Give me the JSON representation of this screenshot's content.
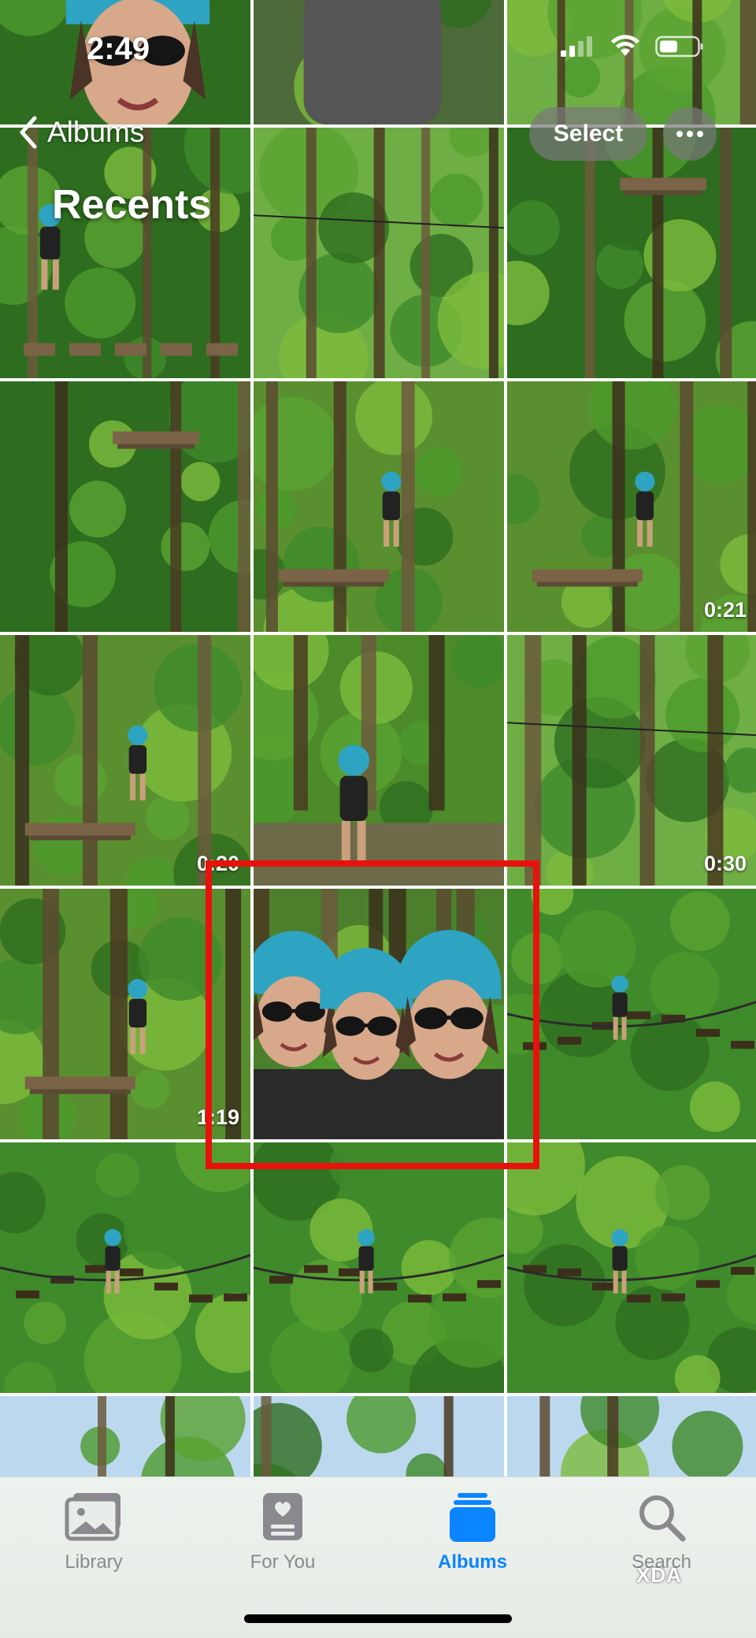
{
  "status_bar": {
    "time": "2:49"
  },
  "nav": {
    "back_label": "Albums",
    "title": "Recents",
    "select_label": "Select"
  },
  "grid": {
    "cells": [
      {
        "scene": "helmet-woman-closeup",
        "duration": ""
      },
      {
        "scene": "woman-tanktop-selfie",
        "duration": ""
      },
      {
        "scene": "forest-canopy",
        "duration": ""
      },
      {
        "scene": "ropes-climber-platforms",
        "duration": ""
      },
      {
        "scene": "tall-trees-lines",
        "duration": ""
      },
      {
        "scene": "tree-platform-ladder",
        "duration": ""
      },
      {
        "scene": "tree-platform",
        "duration": ""
      },
      {
        "scene": "climber-on-tree",
        "duration": ""
      },
      {
        "scene": "climber-platform",
        "duration": "0:21"
      },
      {
        "scene": "climber-pole",
        "duration": "0:20"
      },
      {
        "scene": "woman-ground-waving",
        "duration": ""
      },
      {
        "scene": "tall-trees-sky",
        "duration": "0:30"
      },
      {
        "scene": "climber-pole",
        "duration": "1:19"
      },
      {
        "scene": "three-women-selfie",
        "duration": ""
      },
      {
        "scene": "rope-bridge-canopy",
        "duration": ""
      },
      {
        "scene": "rope-bridge-climber",
        "duration": ""
      },
      {
        "scene": "rope-bridge-climber",
        "duration": ""
      },
      {
        "scene": "rope-bridge-climber",
        "duration": ""
      },
      {
        "scene": "sky-treetops",
        "duration": ""
      },
      {
        "scene": "sky-treetops",
        "duration": ""
      },
      {
        "scene": "sky-treetops",
        "duration": ""
      }
    ]
  },
  "tabbar": {
    "tabs": [
      {
        "label": "Library",
        "icon": "photo-stack-icon",
        "active": false
      },
      {
        "label": "For You",
        "icon": "memories-card-icon",
        "active": false
      },
      {
        "label": "Albums",
        "icon": "album-stack-icon",
        "active": true
      },
      {
        "label": "Search",
        "icon": "magnifier-icon",
        "active": false
      }
    ]
  },
  "watermark": "XDA",
  "colors": {
    "accent": "#0a84ff",
    "highlight_box": "#e8120c",
    "helmet": "#2fa3c2",
    "foliage": "#3f8a2a"
  }
}
